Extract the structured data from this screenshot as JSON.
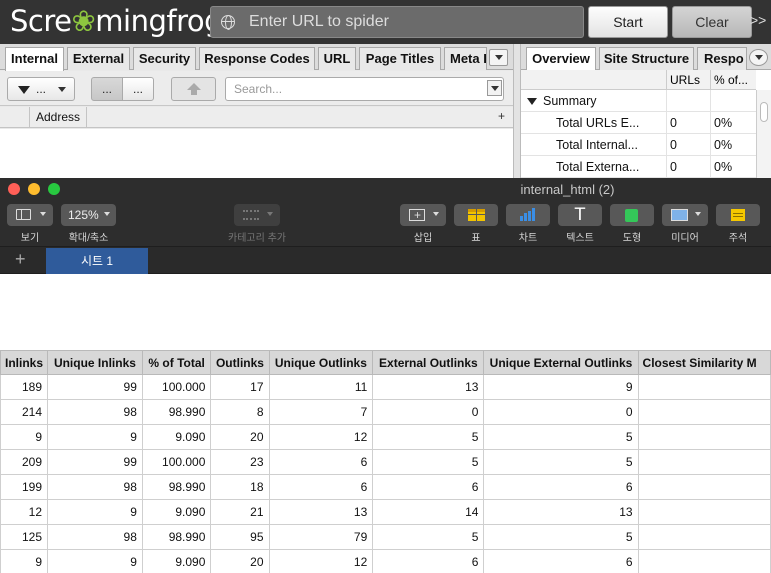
{
  "screaming_frog": {
    "logo_text_before": "Scre",
    "logo_text_after": "mingfrog",
    "url_placeholder": "Enter URL to spider",
    "start_label": "Start",
    "clear_label": "Clear",
    "more_label": ">>",
    "left_tabs": [
      "Internal",
      "External",
      "Security",
      "Response Codes",
      "URL",
      "Page Titles",
      "Meta I"
    ],
    "filter_label": "...",
    "view_btn_1": "...",
    "view_btn_2": "...",
    "search_placeholder": "Search...",
    "table_header": "Address",
    "right_tabs": [
      "Overview",
      "Site Structure",
      "Respo"
    ],
    "overview_columns": [
      "URLs",
      "% of..."
    ],
    "summary_label": "Summary",
    "overview_rows": [
      {
        "label": "Total URLs E...",
        "urls": "0",
        "pct": "0%"
      },
      {
        "label": "Total Internal...",
        "urls": "0",
        "pct": "0%"
      },
      {
        "label": "Total Externa...",
        "urls": "0",
        "pct": "0%"
      }
    ]
  },
  "numbers": {
    "window_title": "internal_html (2)",
    "toolbar_left": [
      {
        "icon": "sidebar-view-icon",
        "label": "보기"
      },
      {
        "icon": "zoom-icon",
        "label": "확대/축소",
        "value": "125%"
      },
      {
        "icon": "category-icon",
        "label": "카테고리 추가"
      }
    ],
    "toolbar_right": [
      {
        "icon": "insert-icon",
        "label": "삽입"
      },
      {
        "icon": "table-icon",
        "label": "표"
      },
      {
        "icon": "chart-icon",
        "label": "차트"
      },
      {
        "icon": "text-icon",
        "label": "텍스트"
      },
      {
        "icon": "shape-icon",
        "label": "도형"
      },
      {
        "icon": "media-icon",
        "label": "미디어"
      },
      {
        "icon": "comment-icon",
        "label": "주석"
      }
    ],
    "add_sheet": "+",
    "sheet_tab": "시트 1",
    "colors": {
      "table_yellow": "#f2c400",
      "chart_blue": "#3a8ee6",
      "shape_green": "#34c759",
      "sheet_tab_blue": "#2f5b9b"
    }
  },
  "spreadsheet": {
    "columns": [
      "Inlinks",
      "Unique Inlinks",
      "% of Total",
      "Outlinks",
      "Unique Outlinks",
      "External Outlinks",
      "Unique External Outlinks",
      "Closest Similarity M"
    ],
    "rows": [
      [
        "189",
        "99",
        "100.000",
        "17",
        "11",
        "13",
        "9",
        ""
      ],
      [
        "214",
        "98",
        "98.990",
        "8",
        "7",
        "0",
        "0",
        ""
      ],
      [
        "9",
        "9",
        "9.090",
        "20",
        "12",
        "5",
        "5",
        ""
      ],
      [
        "209",
        "99",
        "100.000",
        "23",
        "6",
        "5",
        "5",
        ""
      ],
      [
        "199",
        "98",
        "98.990",
        "18",
        "6",
        "6",
        "6",
        ""
      ],
      [
        "12",
        "9",
        "9.090",
        "21",
        "13",
        "14",
        "13",
        ""
      ],
      [
        "125",
        "98",
        "98.990",
        "95",
        "79",
        "5",
        "5",
        ""
      ],
      [
        "9",
        "9",
        "9.090",
        "20",
        "12",
        "6",
        "6",
        ""
      ]
    ]
  }
}
